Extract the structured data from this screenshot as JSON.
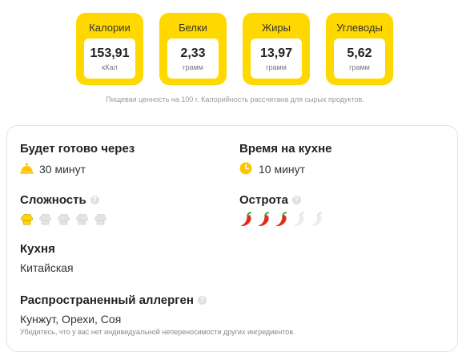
{
  "nutrition": [
    {
      "label": "Калории",
      "value": "153,91",
      "unit": "кКал"
    },
    {
      "label": "Белки",
      "value": "2,33",
      "unit": "грамм"
    },
    {
      "label": "Жиры",
      "value": "13,97",
      "unit": "грамм"
    },
    {
      "label": "Углеводы",
      "value": "5,62",
      "unit": "грамм"
    }
  ],
  "nutrition_note": "Пищевая ценность на 100 г. Калорийность рассчитана для сырых продуктов.",
  "info": {
    "ready_title": "Будет готово через",
    "ready_value": "30 минут",
    "kitchen_title": "Время на кухне",
    "kitchen_value": "10 минут",
    "difficulty_title": "Сложность",
    "difficulty_level": 1,
    "difficulty_max": 5,
    "spiciness_title": "Острота",
    "spiciness_level": 3,
    "spiciness_max": 5,
    "cuisine_title": "Кухня",
    "cuisine_value": "Китайская",
    "allergen_title": "Распространенный аллерген",
    "allergen_value": "Кунжут, Орехи, Соя",
    "allergen_note": "Убедитесь, что у вас нет индивидуальной непереносимости других ингредиентов.",
    "help_glyph": "?"
  },
  "colors": {
    "accent": "#ffd800",
    "clock": "#ffc400",
    "chili": "#e32b1c",
    "inactive": "#e4e4e4"
  }
}
